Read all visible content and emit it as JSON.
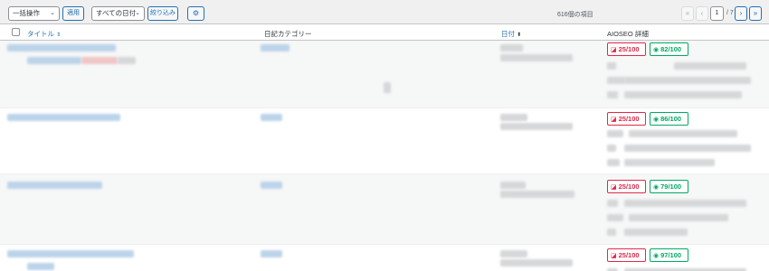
{
  "toolbar": {
    "bulk_actions": "一括操作",
    "apply": "適用",
    "date_filter": "すべての日付",
    "filter": "絞り込み",
    "settings_icon": "gear-icon"
  },
  "pagination": {
    "items_count": "616個の項目",
    "first": "«",
    "prev": "‹",
    "current": "1",
    "total": "/ 7",
    "next": "›",
    "last": "»"
  },
  "table": {
    "columns": {
      "title": "タイトル",
      "category": "日記カテゴリー",
      "date": "日付",
      "aioseo": "AIOSEO 詳細"
    },
    "rows": [
      {
        "seo_score": "25/100",
        "readability": "82/100"
      },
      {
        "seo_score": "25/100",
        "readability": "86/100"
      },
      {
        "seo_score": "25/100",
        "readability": "79/100"
      },
      {
        "seo_score": "25/100",
        "readability": "97/100"
      }
    ]
  },
  "colors": {
    "link": "#2271b1",
    "bad": "#df2a4a",
    "good": "#00aa63"
  }
}
